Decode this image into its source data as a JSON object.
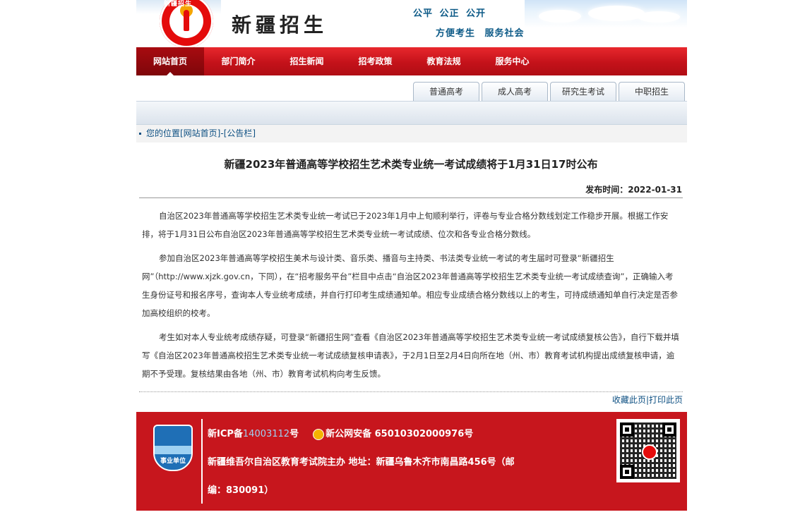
{
  "header": {
    "site_title": "新疆招生",
    "logo_text": "新疆招生",
    "slogan_line1": "公平  公正  公开",
    "slogan_line2": "方便考生  服务社会"
  },
  "nav": {
    "items": [
      "网站首页",
      "部门简介",
      "招生新闻",
      "招考政策",
      "教育法规",
      "服务中心"
    ],
    "active_index": 0
  },
  "subtabs": [
    "普通高考",
    "成人高考",
    "研究生考试",
    "中职招生"
  ],
  "breadcrumb": "您的位置[网站首页]-[公告栏]",
  "article": {
    "title": "新疆2023年普通高等学校招生艺术类专业统一考试成绩将于1月31日17时公布",
    "publish_label": "发布时间：",
    "publish_date": "2022-01-31",
    "paragraphs": [
      "自治区2023年普通高等学校招生艺术类专业统一考试已于2023年1月中上旬顺利举行，评卷与专业合格分数线划定工作稳步开展。根据工作安排，将于1月31日公布自治区2023年普通高等学校招生艺术类专业统一考试成绩、位次和各专业合格分数线。",
      "参加自治区2023年普通高等学校招生美术与设计类、音乐类、播音与主持类、书法类专业统一考试的考生届时可登录“新疆招生网”（http://www.xjzk.gov.cn，下同），在“招考服务平台”栏目中点击“自治区2023年普通高等学校招生艺术类专业统一考试成绩查询”，正确输入考生身份证号和报名序号，查询本人专业统考成绩，并自行打印考生成绩通知单。相应专业成绩合格分数线以上的考生，可持成绩通知单自行决定是否参加高校组织的校考。",
      "考生如对本人专业统考成绩存疑，可登录“新疆招生网”查看《自治区2023年普通高等学校招生艺术类专业统一考试成绩复核公告》，自行下载并填写《自治区2023年普通高校招生艺术类专业统一考试成绩复核申请表》，于2月1日至2月4日向所在地（州、市）教育考试机构提出成绩复核申请，逾期不予受理。复核结果由各地（州、市）教育考试机构向考生反馈。"
    ],
    "links": {
      "favorite": "收藏此页",
      "separator": "|",
      "print": "打印此页"
    }
  },
  "footer": {
    "badge_text": "事业单位",
    "icp_prefix": "新ICP备",
    "icp_number": "14003112",
    "icp_suffix": "号",
    "police_label": "新公网安备 65010302000976号",
    "host_line": "新疆维吾尔自治区教育考试院主办    地址：新疆乌鲁木齐市南昌路456号（邮",
    "zip_line": "编：830091）"
  },
  "colors": {
    "nav_red": "#c4121a",
    "footer_red": "#c7161d",
    "link_blue": "#0c4f82"
  }
}
